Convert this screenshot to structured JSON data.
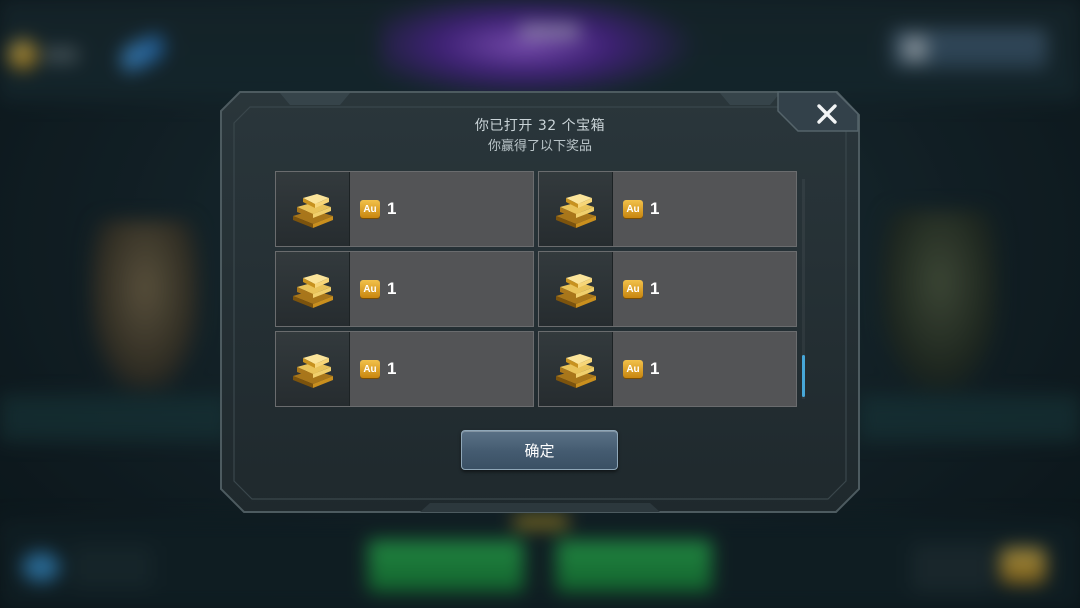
{
  "dialog": {
    "title": "你已打开 32 个宝箱",
    "subtitle": "你赢得了以下奖品",
    "confirm_label": "确定",
    "close_icon": "close-icon"
  },
  "rewards": [
    {
      "icon": "gold-bars-icon",
      "currency": "Au",
      "quantity": "1"
    },
    {
      "icon": "gold-bars-icon",
      "currency": "Au",
      "quantity": "1"
    },
    {
      "icon": "gold-bars-icon",
      "currency": "Au",
      "quantity": "1"
    },
    {
      "icon": "gold-bars-icon",
      "currency": "Au",
      "quantity": "1"
    },
    {
      "icon": "gold-bars-icon",
      "currency": "Au",
      "quantity": "1"
    },
    {
      "icon": "gold-bars-icon",
      "currency": "Au",
      "quantity": "1"
    }
  ],
  "colors": {
    "gold": "#f2c14a",
    "cell": "#535456",
    "button": "#4a6074",
    "scroll_accent": "#47a7d8"
  }
}
